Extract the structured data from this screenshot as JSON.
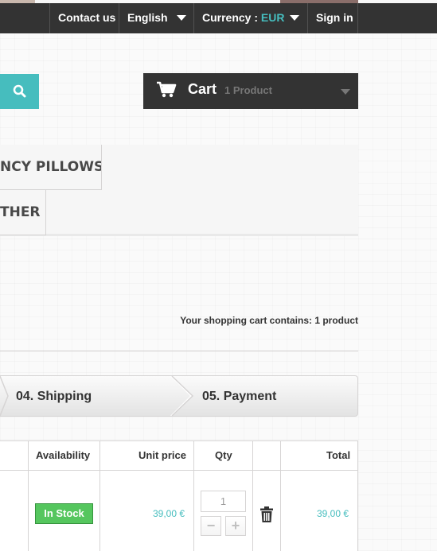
{
  "header": {
    "nav": {
      "contact_label": "Contact us",
      "language_label": "English",
      "currency_prefix": "Currency :",
      "currency_value": "EUR",
      "signin_label": "Sign in"
    },
    "search": {
      "icon": "search-icon"
    },
    "cart": {
      "icon": "shopping-cart-icon",
      "title": "Cart",
      "count": "1 Product"
    }
  },
  "menu": {
    "items": [
      {
        "label": "NCY PILLOWS"
      },
      {
        "label": "THER"
      }
    ]
  },
  "summary": {
    "text": "Your shopping cart contains: 1 product"
  },
  "steps": {
    "shipping": "04. Shipping",
    "payment": "05. Payment"
  },
  "table": {
    "headers": {
      "availability": "Availability",
      "unit_price": "Unit price",
      "qty": "Qty",
      "total": "Total"
    },
    "row": {
      "availability": "In Stock",
      "unit_price": "39,00 €",
      "qty": "1",
      "minus": "−",
      "plus": "+",
      "delete_icon": "trash-icon",
      "total": "39,00 €"
    }
  },
  "colors": {
    "accent": "#46bdbe",
    "dark": "#333333",
    "in_stock": "#55c65e"
  }
}
